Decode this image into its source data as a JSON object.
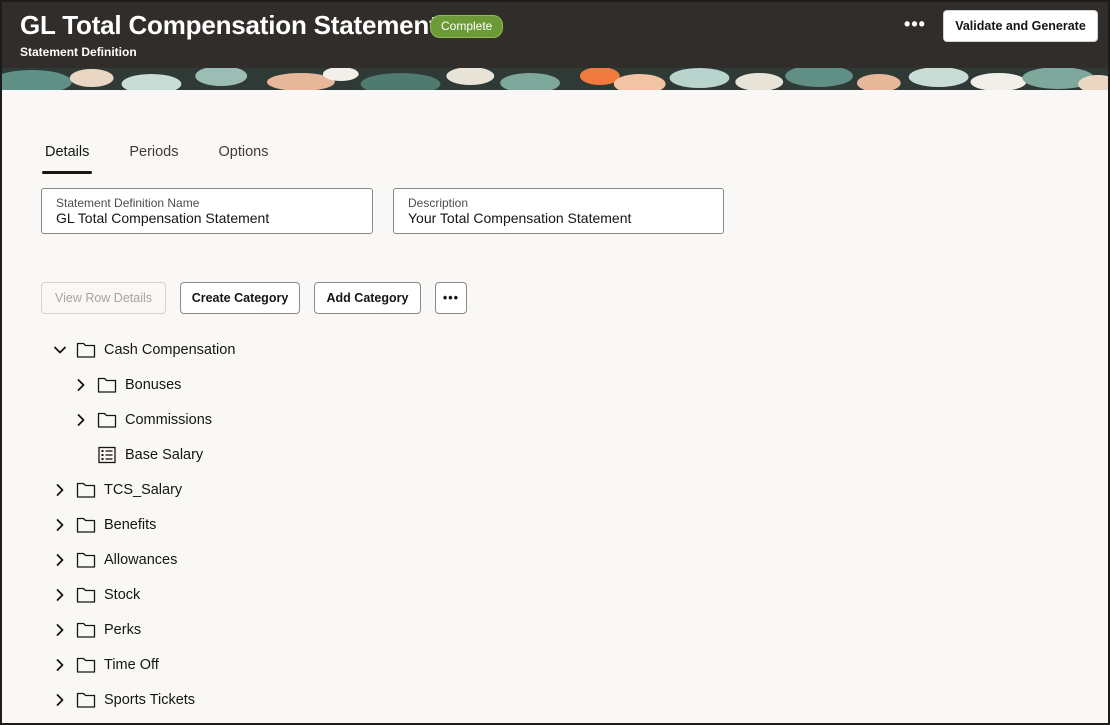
{
  "header": {
    "title": "GL Total Compensation Statement",
    "status_badge": "Complete",
    "subtitle": "Statement Definition",
    "more_label": "•••",
    "primary_action": "Validate and Generate",
    "background_color": "#312d2a",
    "badge_color": "#6c9a36"
  },
  "tabs": [
    {
      "label": "Details",
      "active": true
    },
    {
      "label": "Periods",
      "active": false
    },
    {
      "label": "Options",
      "active": false
    }
  ],
  "fields": {
    "name": {
      "label": "Statement Definition Name",
      "value": "GL Total Compensation Statement"
    },
    "description": {
      "label": "Description",
      "value": "Your Total Compensation Statement"
    }
  },
  "toolbar": {
    "view_row_details": "View Row Details",
    "create_category": "Create Category",
    "add_category": "Add Category",
    "more_label": "•••"
  },
  "tree": [
    {
      "label": "Cash Compensation",
      "expanded": true,
      "icon": "folder-icon"
    },
    {
      "label": "Bonuses",
      "expanded": false,
      "icon": "folder-icon"
    },
    {
      "label": "Commissions",
      "expanded": false,
      "icon": "folder-icon"
    },
    {
      "label": "Base Salary",
      "icon": "list-icon"
    },
    {
      "label": "TCS_Salary",
      "expanded": false,
      "icon": "folder-icon"
    },
    {
      "label": "Benefits",
      "expanded": false,
      "icon": "folder-icon"
    },
    {
      "label": "Allowances",
      "expanded": false,
      "icon": "folder-icon"
    },
    {
      "label": "Stock",
      "expanded": false,
      "icon": "folder-icon"
    },
    {
      "label": "Perks",
      "expanded": false,
      "icon": "folder-icon"
    },
    {
      "label": "Time Off",
      "expanded": false,
      "icon": "folder-icon"
    },
    {
      "label": "Sports Tickets",
      "expanded": false,
      "icon": "folder-icon"
    }
  ]
}
